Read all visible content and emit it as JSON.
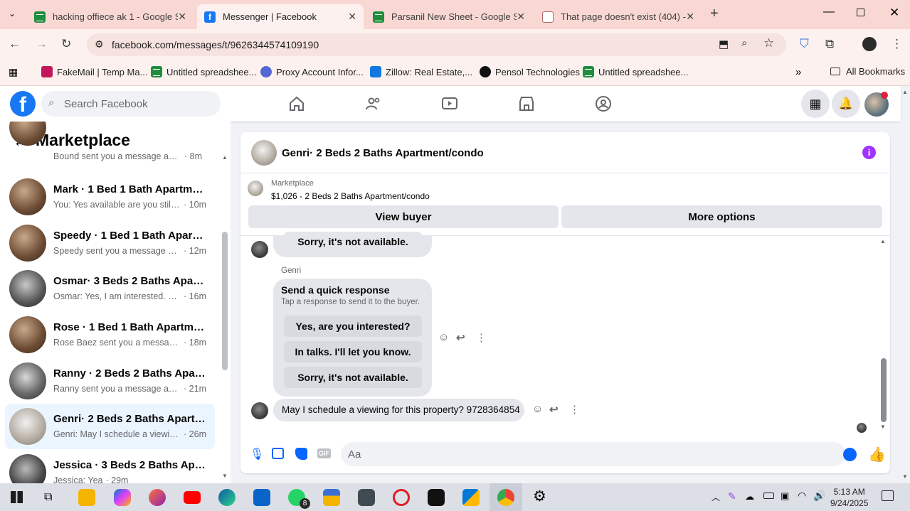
{
  "browser": {
    "tabs": [
      {
        "title": "hacking offiece ak 1 - Google Sheets",
        "icon": "sheets-icon"
      },
      {
        "title": "Messenger | Facebook",
        "icon": "facebook-icon"
      },
      {
        "title": "Parsanil New Sheet - Google Sheets",
        "icon": "sheets-icon"
      },
      {
        "title": "That page doesn't exist (404) - Facebook",
        "icon": "error-icon"
      }
    ],
    "url": "facebook.com/messages/t/9626344574109190",
    "bookmarks": [
      {
        "label": "FakeMail | Temp Ma...",
        "icon": "fakemail-icon"
      },
      {
        "label": "Untitled spreadshee...",
        "icon": "sheets-icon"
      },
      {
        "label": "Proxy Account Infor...",
        "icon": "proxy-icon"
      },
      {
        "label": "Zillow: Real Estate,...",
        "icon": "zillow-icon"
      },
      {
        "label": "Pensol Technologies",
        "icon": "pensol-icon"
      },
      {
        "label": "Untitled spreadshee...",
        "icon": "sheets-icon"
      }
    ],
    "all_bookmarks": "All Bookmarks"
  },
  "facebook": {
    "search_placeholder": "Search Facebook"
  },
  "sidebar": {
    "title": "Marketplace",
    "conversations": [
      {
        "name": "",
        "preview": "Bound sent you a message about ...",
        "time": "· 8m"
      },
      {
        "name": "Mark · 1 Bed 1 Bath Apartment/...",
        "preview": "You: Yes available are you still int...",
        "time": "· 10m"
      },
      {
        "name": "Speedy · 1 Bed 1 Bath Apartmen...",
        "preview": "Speedy sent you a message abou...",
        "time": "· 12m"
      },
      {
        "name": "Osmar· 3 Beds 2 Baths Apartme...",
        "preview": "Osmar: Yes, I am interested. My n...",
        "time": "· 16m"
      },
      {
        "name": "Rose · 1 Bed 1 Bath Apartment/c...",
        "preview": "Rose Baez sent you a message a...",
        "time": "· 18m"
      },
      {
        "name": "Ranny · 2 Beds 2 Baths Apartme...",
        "preview": "Ranny sent you a message about...",
        "time": "· 21m"
      },
      {
        "name": "Genri· 2 Beds 2 Baths Apartmen...",
        "preview": "Genri: May I schedule a viewing f...",
        "time": "· 26m"
      },
      {
        "name": "Jessica · 3 Beds 2 Baths Apartm...",
        "preview": "Jessica: Yea",
        "time": "· 29m"
      }
    ]
  },
  "chat": {
    "title": "Genri· 2 Beds 2 Baths Apartment/condo",
    "listing_label": "Marketplace",
    "listing_detail": "$1,026 - 2 Beds 2 Baths Apartment/condo",
    "view_buyer": "View buyer",
    "more_options": "More options",
    "prev_reply": "Sorry, it's not available.",
    "sender": "Genri",
    "quick_title": "Send a quick response",
    "quick_sub": "Tap a response to send it to the buyer.",
    "quick_options": [
      "Yes, are you interested?",
      "In talks. I'll let you know.",
      "Sorry, it's not available."
    ],
    "last_message": "May I schedule a viewing for this property? 9728364854",
    "composer_placeholder": "Aa"
  },
  "taskbar": {
    "time": "5:13 AM",
    "date": "9/24/2025",
    "whatsapp_badge": "8"
  },
  "colors": {
    "facebook_blue": "#1877f2",
    "selected_conv_bg": "#ebf5ff",
    "bubble_gray": "#e4e6eb",
    "info_purple": "#a033ff",
    "tabstrip": "#f9d8d3"
  }
}
